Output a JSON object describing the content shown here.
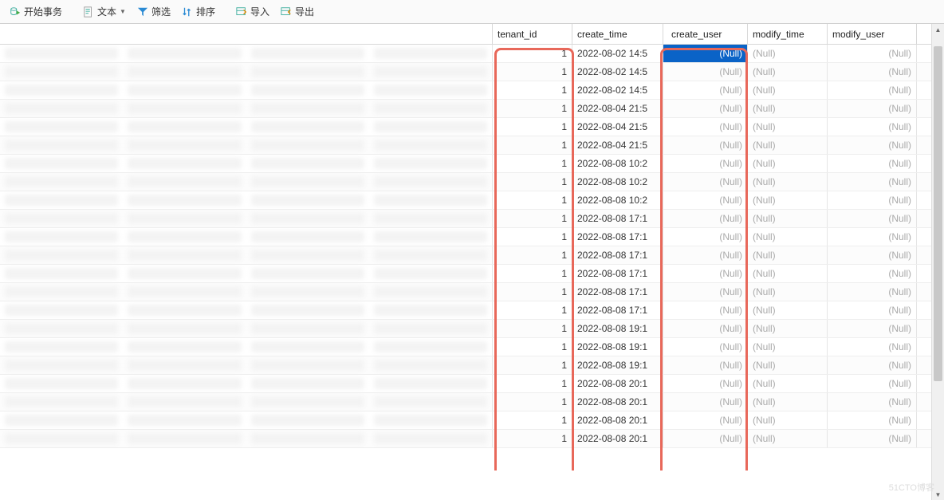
{
  "toolbar": {
    "begin_tx": "开始事务",
    "text": "文本",
    "filter": "筛选",
    "sort": "排序",
    "import": "导入",
    "export": "导出"
  },
  "columns": {
    "tenant_id": "tenant_id",
    "create_time": "create_time",
    "create_user": "create_user",
    "modify_time": "modify_time",
    "modify_user": "modify_user"
  },
  "null_label": "(Null)",
  "rows": [
    {
      "tenant_id": "1",
      "create_time": "2022-08-02 14:5",
      "create_user": "(Null)",
      "modify_time": "(Null)",
      "modify_user": "(Null)"
    },
    {
      "tenant_id": "1",
      "create_time": "2022-08-02 14:5",
      "create_user": "(Null)",
      "modify_time": "(Null)",
      "modify_user": "(Null)"
    },
    {
      "tenant_id": "1",
      "create_time": "2022-08-02 14:5",
      "create_user": "(Null)",
      "modify_time": "(Null)",
      "modify_user": "(Null)"
    },
    {
      "tenant_id": "1",
      "create_time": "2022-08-04 21:5",
      "create_user": "(Null)",
      "modify_time": "(Null)",
      "modify_user": "(Null)"
    },
    {
      "tenant_id": "1",
      "create_time": "2022-08-04 21:5",
      "create_user": "(Null)",
      "modify_time": "(Null)",
      "modify_user": "(Null)"
    },
    {
      "tenant_id": "1",
      "create_time": "2022-08-04 21:5",
      "create_user": "(Null)",
      "modify_time": "(Null)",
      "modify_user": "(Null)"
    },
    {
      "tenant_id": "1",
      "create_time": "2022-08-08 10:2",
      "create_user": "(Null)",
      "modify_time": "(Null)",
      "modify_user": "(Null)"
    },
    {
      "tenant_id": "1",
      "create_time": "2022-08-08 10:2",
      "create_user": "(Null)",
      "modify_time": "(Null)",
      "modify_user": "(Null)"
    },
    {
      "tenant_id": "1",
      "create_time": "2022-08-08 10:2",
      "create_user": "(Null)",
      "modify_time": "(Null)",
      "modify_user": "(Null)"
    },
    {
      "tenant_id": "1",
      "create_time": "2022-08-08 17:1",
      "create_user": "(Null)",
      "modify_time": "(Null)",
      "modify_user": "(Null)"
    },
    {
      "tenant_id": "1",
      "create_time": "2022-08-08 17:1",
      "create_user": "(Null)",
      "modify_time": "(Null)",
      "modify_user": "(Null)"
    },
    {
      "tenant_id": "1",
      "create_time": "2022-08-08 17:1",
      "create_user": "(Null)",
      "modify_time": "(Null)",
      "modify_user": "(Null)"
    },
    {
      "tenant_id": "1",
      "create_time": "2022-08-08 17:1",
      "create_user": "(Null)",
      "modify_time": "(Null)",
      "modify_user": "(Null)"
    },
    {
      "tenant_id": "1",
      "create_time": "2022-08-08 17:1",
      "create_user": "(Null)",
      "modify_time": "(Null)",
      "modify_user": "(Null)"
    },
    {
      "tenant_id": "1",
      "create_time": "2022-08-08 17:1",
      "create_user": "(Null)",
      "modify_time": "(Null)",
      "modify_user": "(Null)"
    },
    {
      "tenant_id": "1",
      "create_time": "2022-08-08 19:1",
      "create_user": "(Null)",
      "modify_time": "(Null)",
      "modify_user": "(Null)"
    },
    {
      "tenant_id": "1",
      "create_time": "2022-08-08 19:1",
      "create_user": "(Null)",
      "modify_time": "(Null)",
      "modify_user": "(Null)"
    },
    {
      "tenant_id": "1",
      "create_time": "2022-08-08 19:1",
      "create_user": "(Null)",
      "modify_time": "(Null)",
      "modify_user": "(Null)"
    },
    {
      "tenant_id": "1",
      "create_time": "2022-08-08 20:1",
      "create_user": "(Null)",
      "modify_time": "(Null)",
      "modify_user": "(Null)"
    },
    {
      "tenant_id": "1",
      "create_time": "2022-08-08 20:1",
      "create_user": "(Null)",
      "modify_time": "(Null)",
      "modify_user": "(Null)"
    },
    {
      "tenant_id": "1",
      "create_time": "2022-08-08 20:1",
      "create_user": "(Null)",
      "modify_time": "(Null)",
      "modify_user": "(Null)"
    },
    {
      "tenant_id": "1",
      "create_time": "2022-08-08 20:1",
      "create_user": "(Null)",
      "modify_time": "(Null)",
      "modify_user": "(Null)"
    }
  ],
  "selected_cell": {
    "row": 0,
    "col": "create_user"
  },
  "watermark": "51CTO博客"
}
